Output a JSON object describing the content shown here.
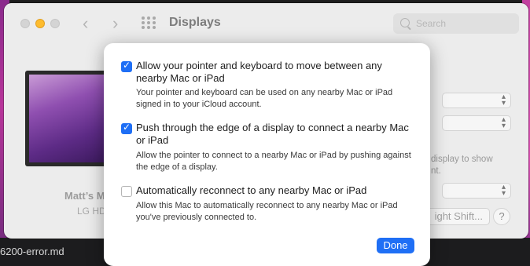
{
  "desktop": {
    "bottom_filename": "6200-error.md"
  },
  "window": {
    "title": "Displays",
    "nav": {
      "back_glyph": "‹",
      "forward_glyph": "›"
    },
    "search": {
      "placeholder": "Search"
    },
    "monitor": {
      "name": "Matt’s M",
      "model": "LG HD"
    },
    "background_text": {
      "line1": "display to show",
      "line2": "nt."
    },
    "buttons": {
      "night_shift": "ight Shift...",
      "help": "?"
    }
  },
  "sheet": {
    "options": [
      {
        "checked": true,
        "title": "Allow your pointer and keyboard to move between any nearby Mac or iPad",
        "description": "Your pointer and keyboard can be used on any nearby Mac or iPad signed in to your iCloud account."
      },
      {
        "checked": true,
        "title": "Push through the edge of a display to connect a nearby Mac or iPad",
        "description": "Allow the pointer to connect to a nearby Mac or iPad by pushing against the edge of a display."
      },
      {
        "checked": false,
        "title": "Automatically reconnect to any nearby Mac or iPad",
        "description": "Allow this Mac to automatically reconnect to any nearby Mac or iPad you've previously connected to."
      }
    ],
    "done_label": "Done"
  },
  "colors": {
    "accent": "#1f6ff5",
    "window_bg": "#ececec",
    "minimize": "#febc2e"
  }
}
